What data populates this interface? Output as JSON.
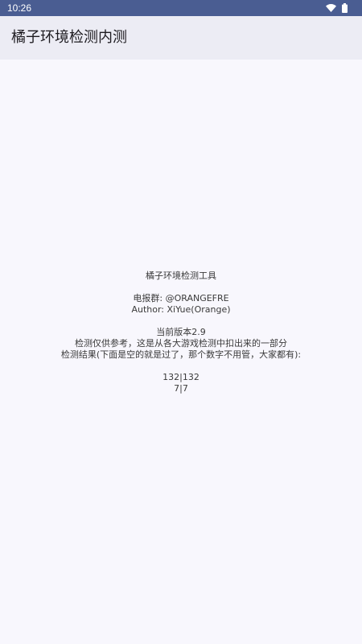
{
  "status_bar": {
    "time": "10:26",
    "icons": [
      "wifi-icon",
      "battery-icon"
    ],
    "background": "#4a5d92"
  },
  "app_bar": {
    "title": "橘子环境检测内测"
  },
  "main": {
    "tool_name": "橘子环境检测工具",
    "group_line": "电报群: @ORANGEFRE",
    "author_line": "Author: XiYue(Orange)",
    "version_line": "当前版本2.9",
    "note_line": "检测仅供参考，这是从各大游戏检测中扣出来的一部分",
    "result_header": "检测结果(下面是空的就是过了，那个数字不用管，大家都有):",
    "count_1": "132|132",
    "count_2": "7|7"
  }
}
